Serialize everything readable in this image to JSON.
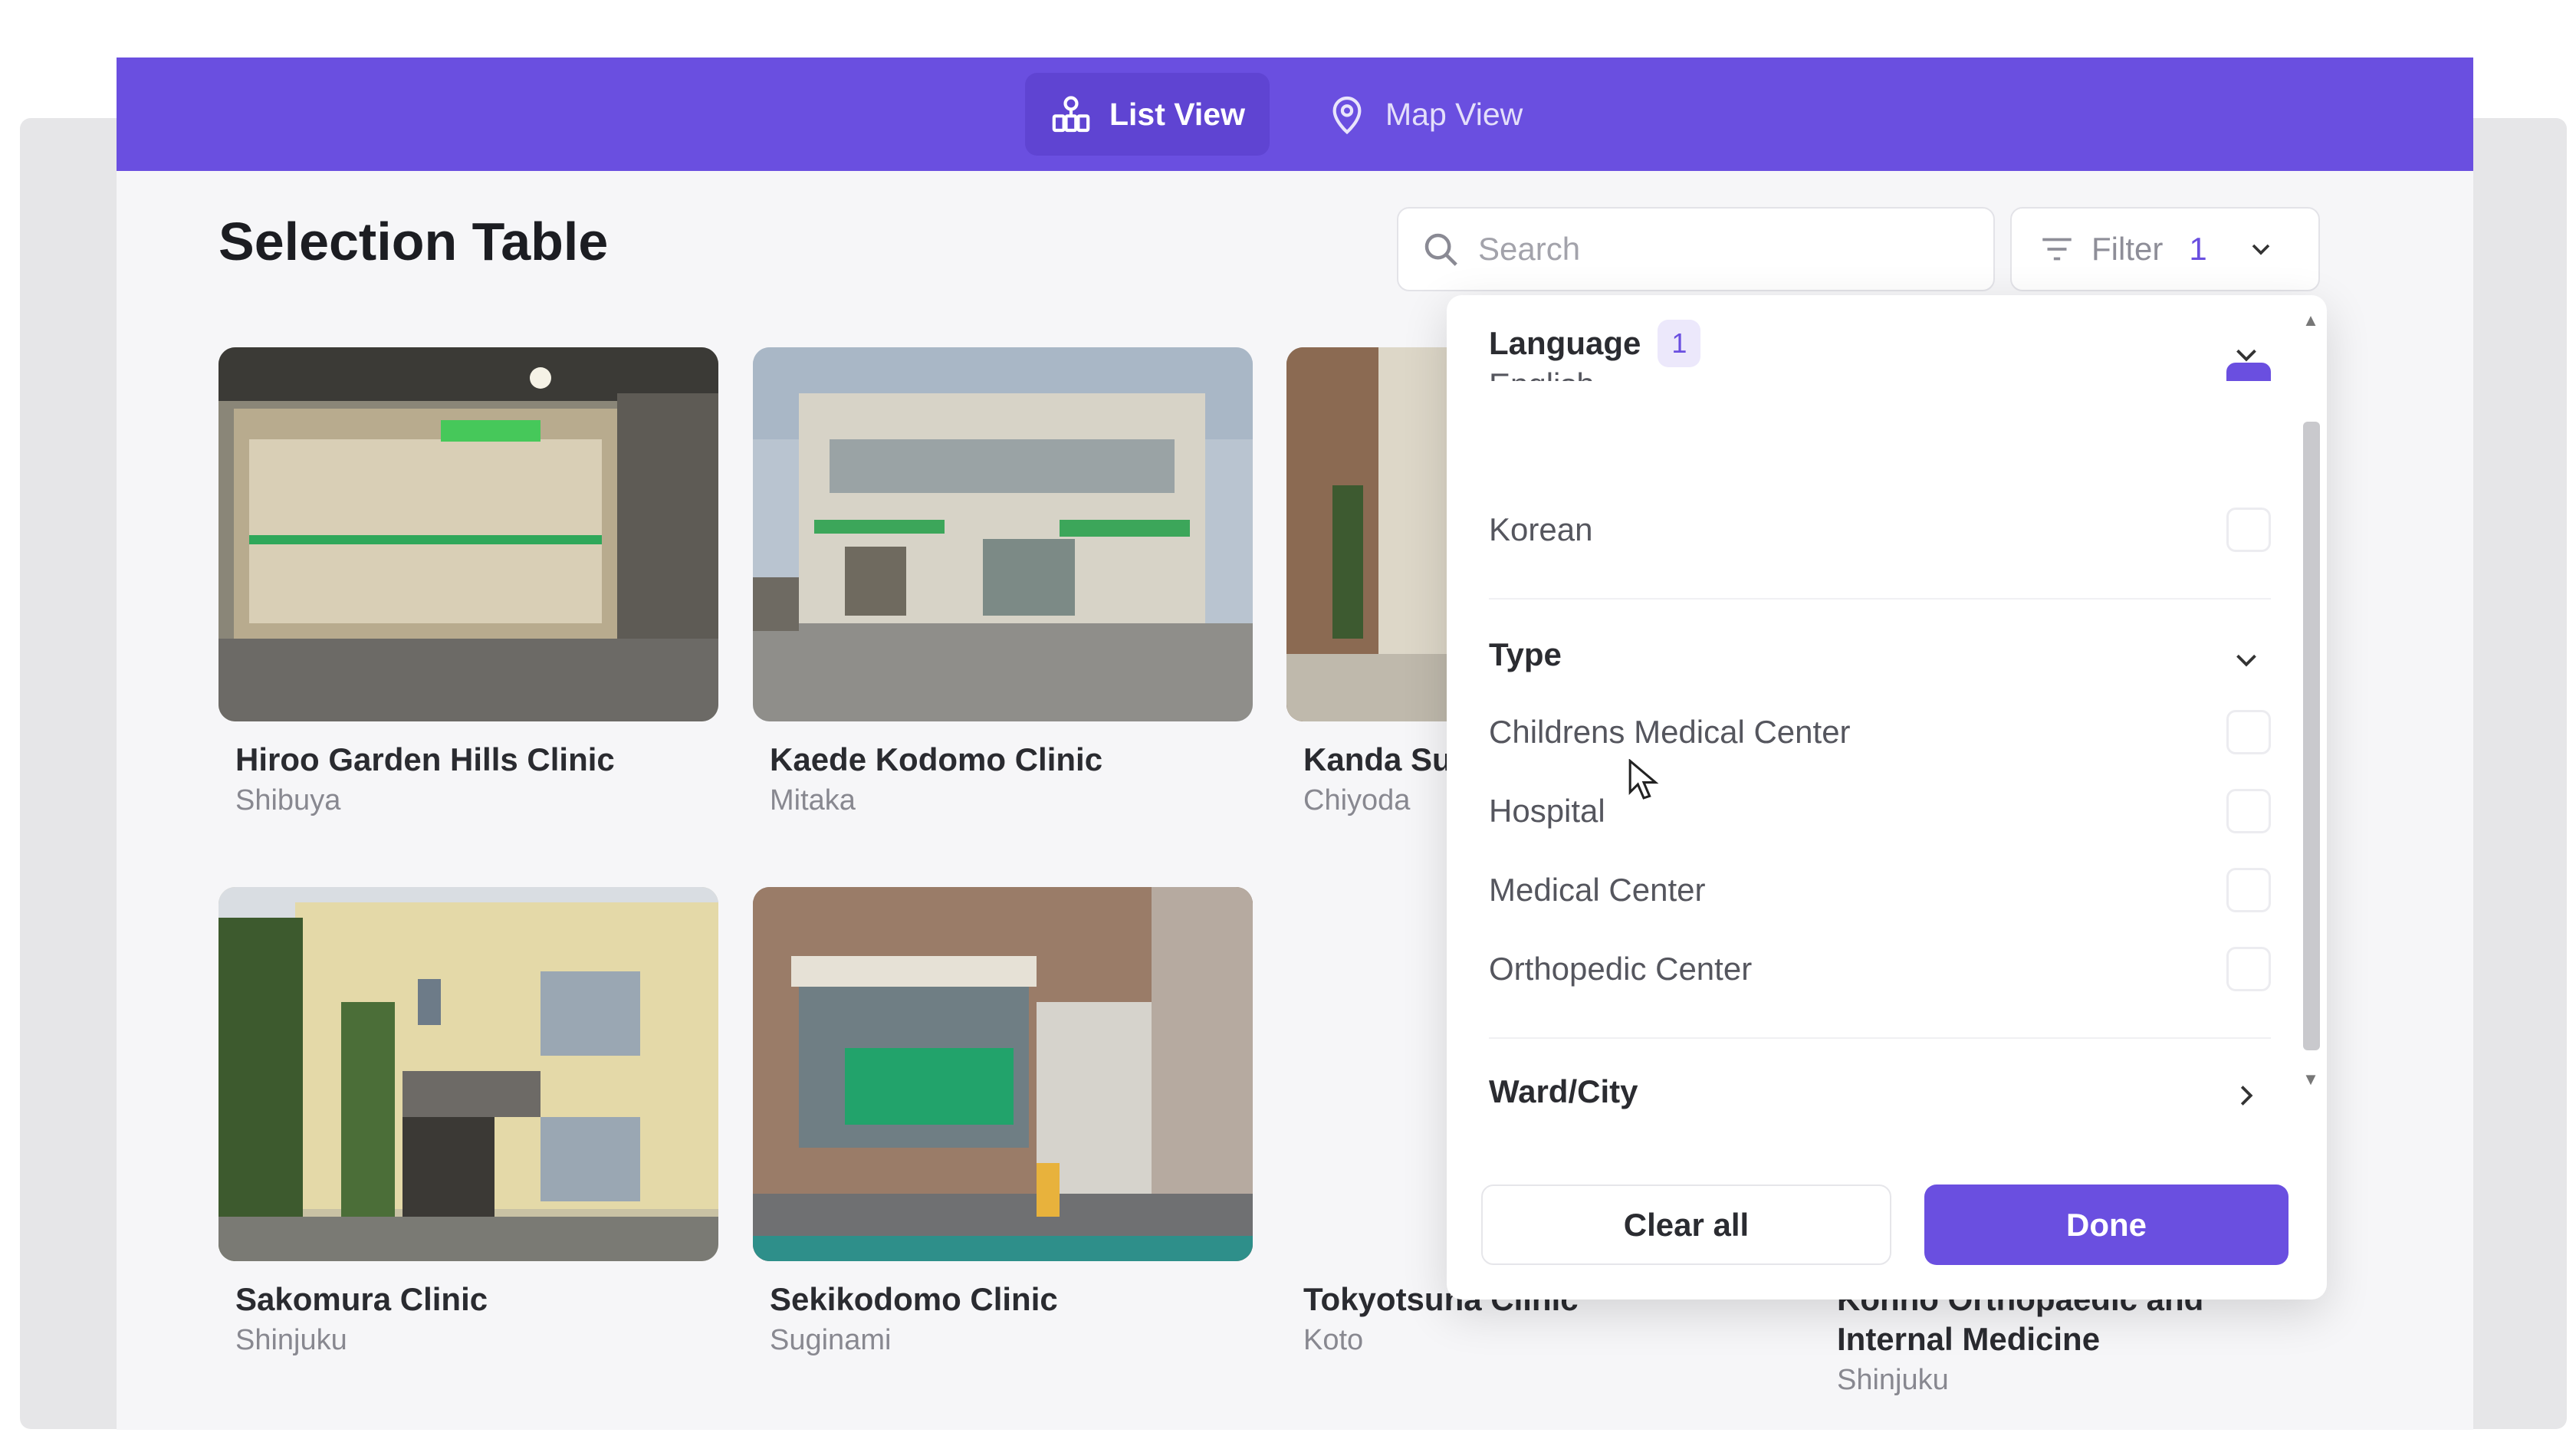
{
  "tabs": [
    {
      "label": "List View",
      "icon": "buildings-icon",
      "active": true
    },
    {
      "label": "Map View",
      "icon": "map-pin-icon",
      "active": false
    }
  ],
  "page_title": "Selection Table",
  "search": {
    "placeholder": "Search",
    "value": ""
  },
  "filter": {
    "label": "Filter",
    "count": "1"
  },
  "clinics": [
    {
      "name": "Hiroo Garden Hills Clinic",
      "ward": "Shibuya"
    },
    {
      "name": "Kaede Kodomo Clinic",
      "ward": "Mitaka"
    },
    {
      "name": "Kanda Su",
      "ward": "Chiyoda"
    },
    {
      "name": "Sakomura Clinic",
      "ward": "Shinjuku"
    },
    {
      "name": "Sekikodomo Clinic",
      "ward": "Suginami"
    },
    {
      "name": "Tokyotsuna Clinic",
      "ward": "Koto"
    },
    {
      "name": "Konno Orthopaedic and Internal Medicine",
      "ward": "Shinjuku"
    }
  ],
  "filter_panel": {
    "language": {
      "title": "Language",
      "badge": "1",
      "options": [
        {
          "label": "English",
          "checked": true
        },
        {
          "label": "Korean",
          "checked": false
        }
      ]
    },
    "type": {
      "title": "Type",
      "options": [
        {
          "label": "Childrens Medical Center",
          "checked": false
        },
        {
          "label": "Hospital",
          "checked": false
        },
        {
          "label": "Medical Center",
          "checked": false
        },
        {
          "label": "Orthopedic Center",
          "checked": false
        }
      ]
    },
    "ward_city": {
      "title": "Ward/City"
    },
    "clear_label": "Clear all",
    "done_label": "Done"
  },
  "colors": {
    "accent": "#6a4fe0",
    "header": "#6a4fe0"
  }
}
